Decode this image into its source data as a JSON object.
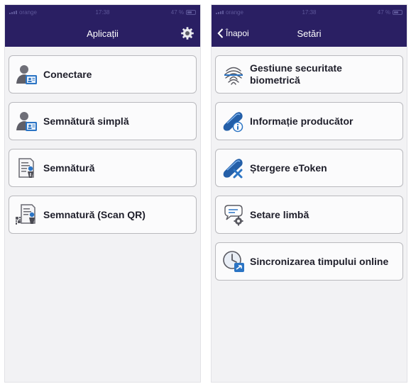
{
  "left": {
    "status": {
      "carrier": "orange",
      "time": "17:38",
      "battery": "47 %"
    },
    "nav_title": "Aplicații",
    "items": [
      {
        "label": "Conectare",
        "icon": "user-card-icon"
      },
      {
        "label": "Semnătură simplă",
        "icon": "user-card-icon"
      },
      {
        "label": "Semnătură",
        "icon": "document-pen-icon"
      },
      {
        "label": "Semnatură (Scan QR)",
        "icon": "qr-document-pen-icon"
      }
    ]
  },
  "right": {
    "status": {
      "carrier": "orange",
      "time": "17:38",
      "battery": "47 %"
    },
    "back_label": "Înapoi",
    "nav_title": "Setări",
    "items": [
      {
        "label": "Gestiune securitate biometrică",
        "icon": "fingerprint-icon"
      },
      {
        "label": "Informație producător",
        "icon": "token-info-icon"
      },
      {
        "label": "Ștergere eToken",
        "icon": "token-delete-icon"
      },
      {
        "label": "Setare limbă",
        "icon": "language-bubble-icon"
      },
      {
        "label": "Sincronizarea timpului online",
        "icon": "clock-sync-icon"
      }
    ]
  },
  "colors": {
    "navbar": "#2a1f63",
    "card_border": "#b9b9bd",
    "background": "#f2f2f4"
  }
}
